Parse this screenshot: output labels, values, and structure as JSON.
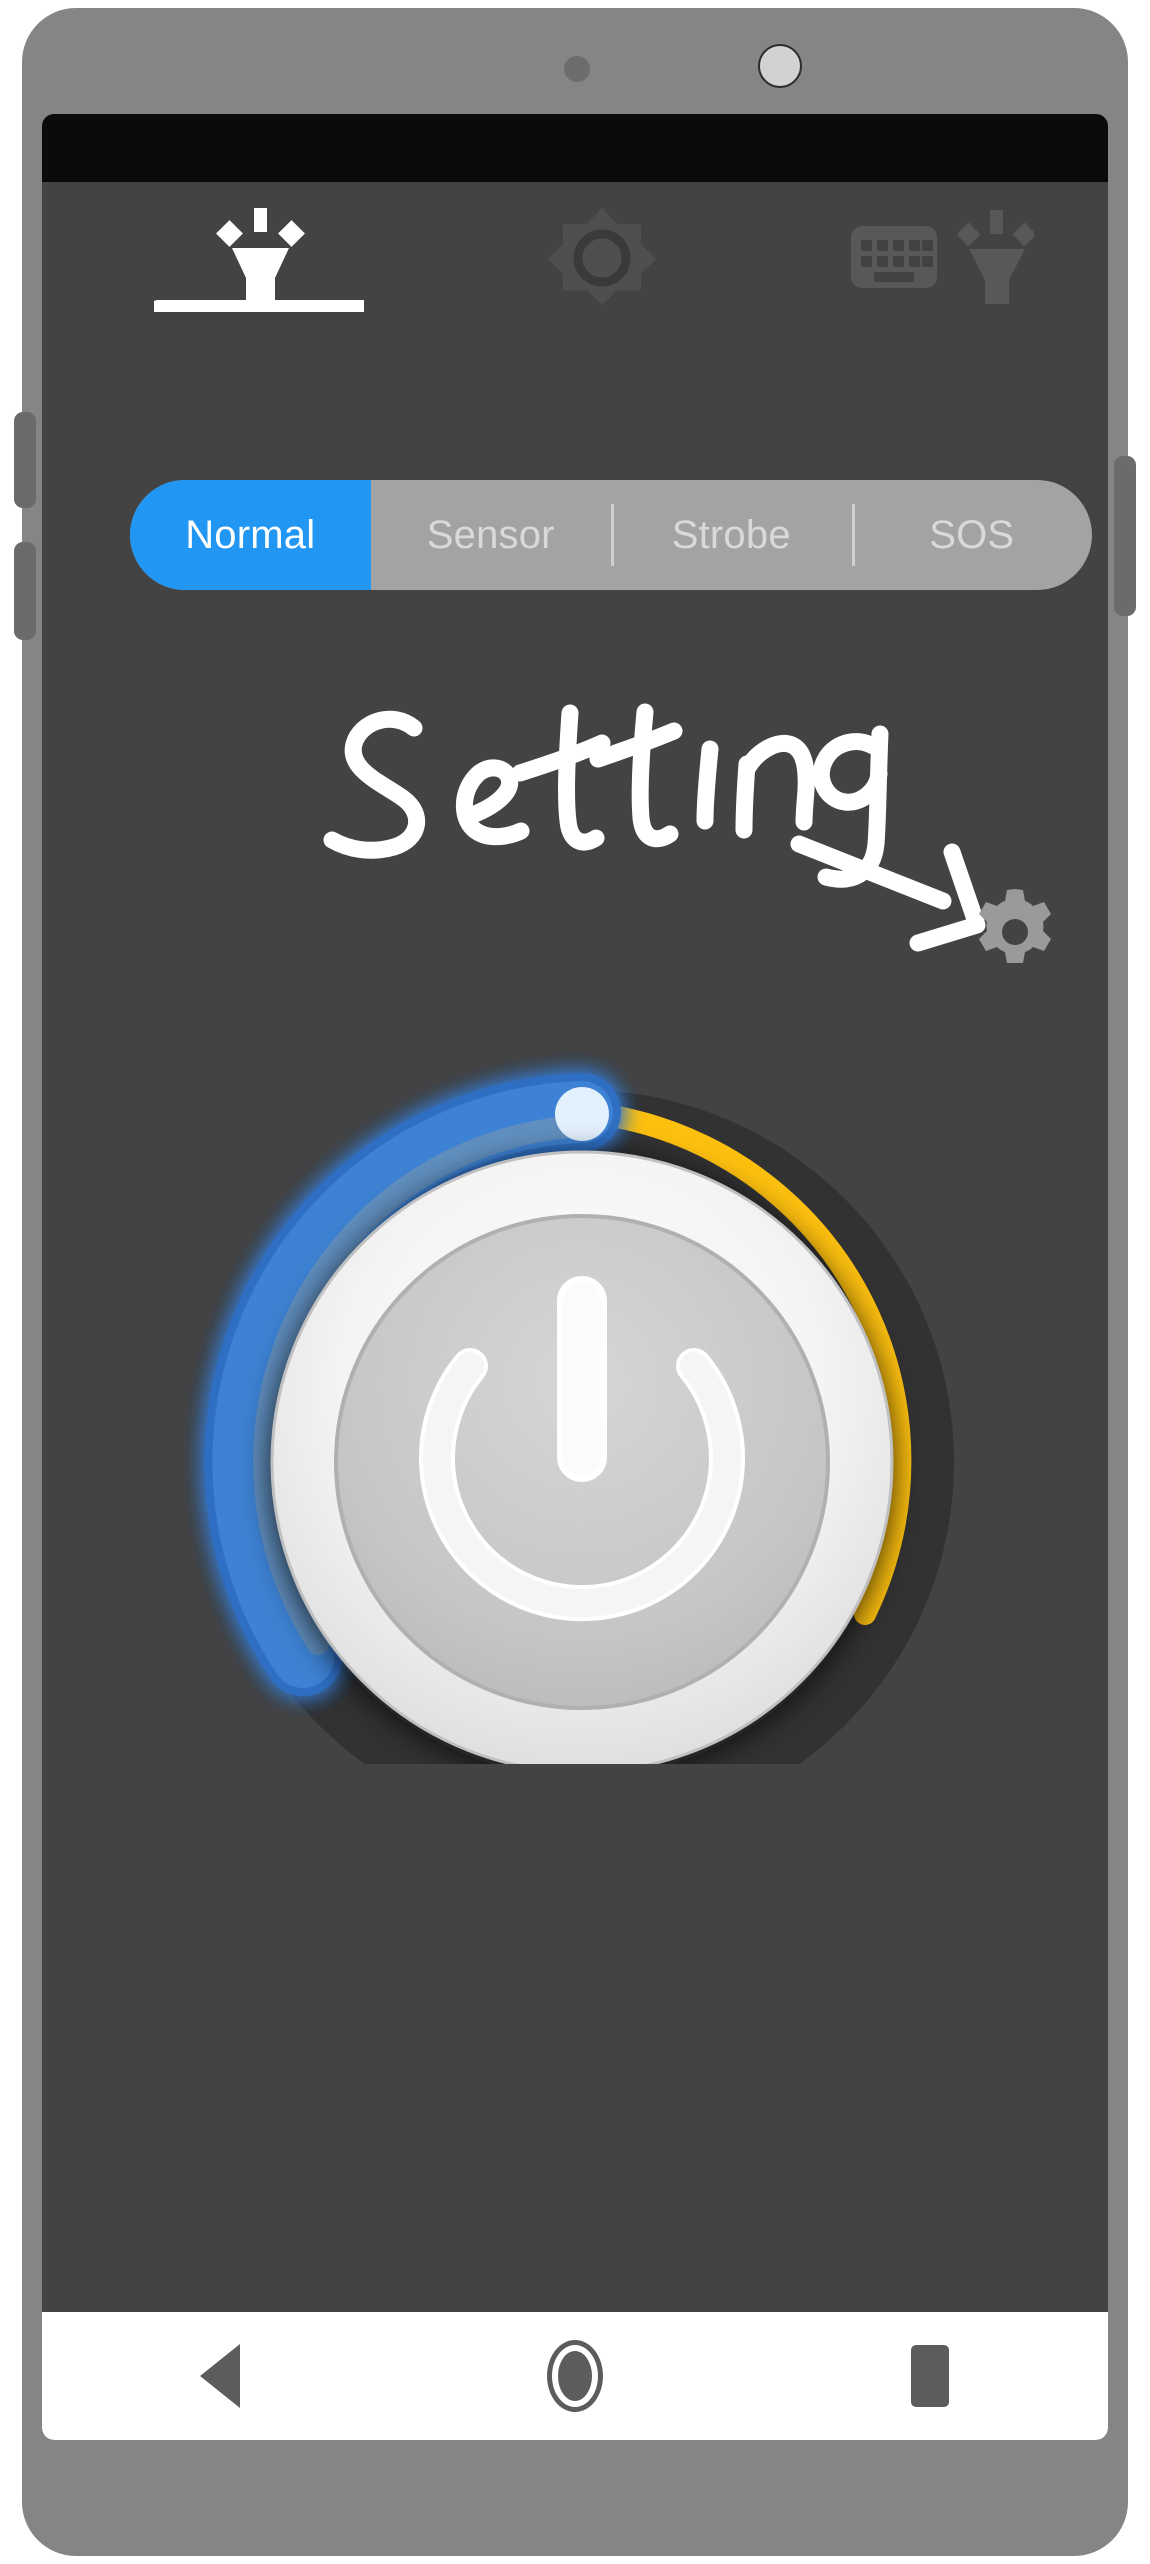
{
  "device": {
    "name": "android-phone",
    "frame_color": "#858585",
    "screen_bg": "#434343",
    "status_bar_color": "#0b0b0b",
    "hardware_buttons": [
      {
        "name": "volume-up-button",
        "side": "left"
      },
      {
        "name": "volume-down-button",
        "side": "left"
      },
      {
        "name": "power-button",
        "side": "right"
      }
    ],
    "sensors": [
      {
        "name": "proximity-sensor"
      },
      {
        "name": "front-camera"
      }
    ]
  },
  "app": {
    "title": "Flashlight",
    "toolbar": {
      "items": [
        {
          "label": "Flashlight",
          "icon": "flashlight-icon",
          "active": true
        },
        {
          "label": "Brightness",
          "icon": "brightness-sun-icon",
          "active": false
        },
        {
          "label": "Keyboard",
          "icon": "keyboard-icon",
          "active": false
        },
        {
          "label": "Torch",
          "icon": "torch-icon",
          "active": false
        }
      ]
    },
    "mode_tabs": {
      "selected": "Normal",
      "selected_color": "#2196f3",
      "track_color": "#a3a3a3",
      "items": [
        {
          "label": "Normal",
          "active": true
        },
        {
          "label": "Sensor",
          "active": false
        },
        {
          "label": "Strobe",
          "active": false
        },
        {
          "label": "SOS",
          "active": false
        }
      ]
    },
    "annotation": {
      "text": "Setting",
      "color": "#ffffff",
      "arrow": "curved-arrow-pointing-to-gear"
    },
    "settings_button": {
      "icon": "gear-icon",
      "color": "#9a9a9a",
      "label": "Settings"
    },
    "power_dial": {
      "label": "Power",
      "center_icon": "power-icon",
      "track_blue_color": "#3b82d6",
      "track_yellow_color": "#fdc00f",
      "knob_color": "#e3f0fd",
      "glow_color": "#1f56c8",
      "button_face_color": "#f2f2f2",
      "value_percent": 48
    }
  },
  "nav_bar": {
    "background": "#ffffff",
    "icon_color": "#5c5c5c",
    "buttons": [
      {
        "label": "Back",
        "icon": "back-triangle-icon"
      },
      {
        "label": "Home",
        "icon": "home-circle-icon"
      },
      {
        "label": "Recents",
        "icon": "recents-square-icon"
      }
    ]
  }
}
